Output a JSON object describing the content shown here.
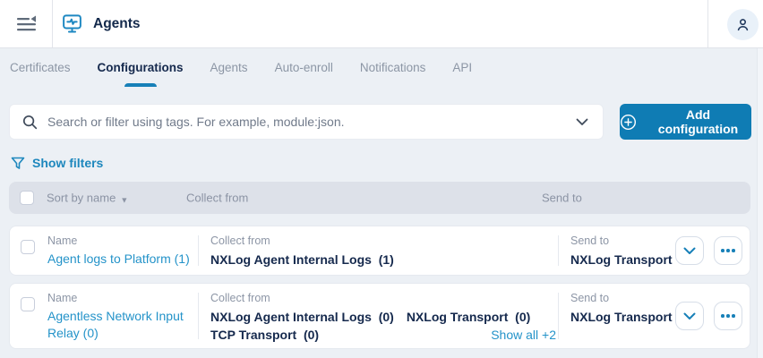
{
  "topbar": {
    "title": "Agents"
  },
  "tabs": {
    "items": [
      {
        "label": "Certificates"
      },
      {
        "label": "Configurations"
      },
      {
        "label": "Agents"
      },
      {
        "label": "Auto-enroll"
      },
      {
        "label": "Notifications"
      },
      {
        "label": "API"
      }
    ],
    "active": "Configurations"
  },
  "search": {
    "placeholder": "Search or filter using tags. For example, module:json."
  },
  "toolbar": {
    "add_button_label": "Add configuration"
  },
  "filters": {
    "show_filters_label": "Show filters"
  },
  "table": {
    "header": {
      "sort_label": "Sort by name",
      "collect_label": "Collect from",
      "send_label": "Send to"
    },
    "rows": [
      {
        "name_label": "Name",
        "name": "Agent logs to Platform (1)",
        "collect_label": "Collect from",
        "collect_items": [
          "NXLog Agent Internal Logs  (1)"
        ],
        "send_label": "Send to",
        "send_value": "NXLog Transport"
      },
      {
        "name_label": "Name",
        "name": "Agentless Network Input Relay (0)",
        "collect_label": "Collect from",
        "collect_items": [
          "NXLog Agent Internal Logs  (0)",
          "NXLog Transport  (0)",
          "TCP Transport  (0)"
        ],
        "show_all_label": "Show all +2",
        "send_label": "Send to",
        "send_value": "NXLog Transport"
      }
    ]
  },
  "colors": {
    "accent_blue": "#0f7cb4",
    "link_blue": "#2493c9",
    "icon_blue": "#1780b8",
    "navy": "#15294d"
  }
}
